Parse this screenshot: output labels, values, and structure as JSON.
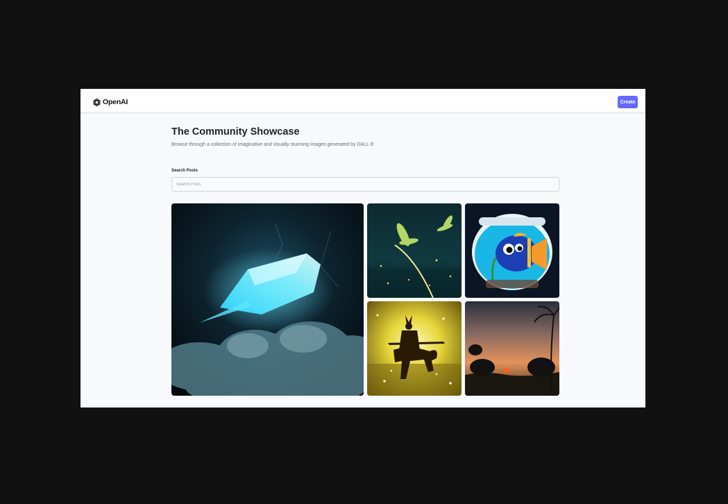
{
  "header": {
    "logo_text": "OpenAI",
    "logo_icon": "openai-logo-icon",
    "create_label": "Create"
  },
  "main": {
    "title": "The Community Showcase",
    "subtitle": "Browse through a collection of imaginative and visually stunning images generated by DALL-E",
    "search_label": "Search Posts",
    "search_placeholder": "Search Posts",
    "search_value": ""
  },
  "posts": [
    {
      "subject": "glowing crystal ship over clouds"
    },
    {
      "subject": "glowing dragonflies at night"
    },
    {
      "subject": "blue fish in fishbowl"
    },
    {
      "subject": "samurai on horseback"
    },
    {
      "subject": "sunset with palm trees"
    }
  ],
  "colors": {
    "accent": "#6469ff",
    "page_bg": "#f8f9fc",
    "backdrop": "#111111"
  }
}
